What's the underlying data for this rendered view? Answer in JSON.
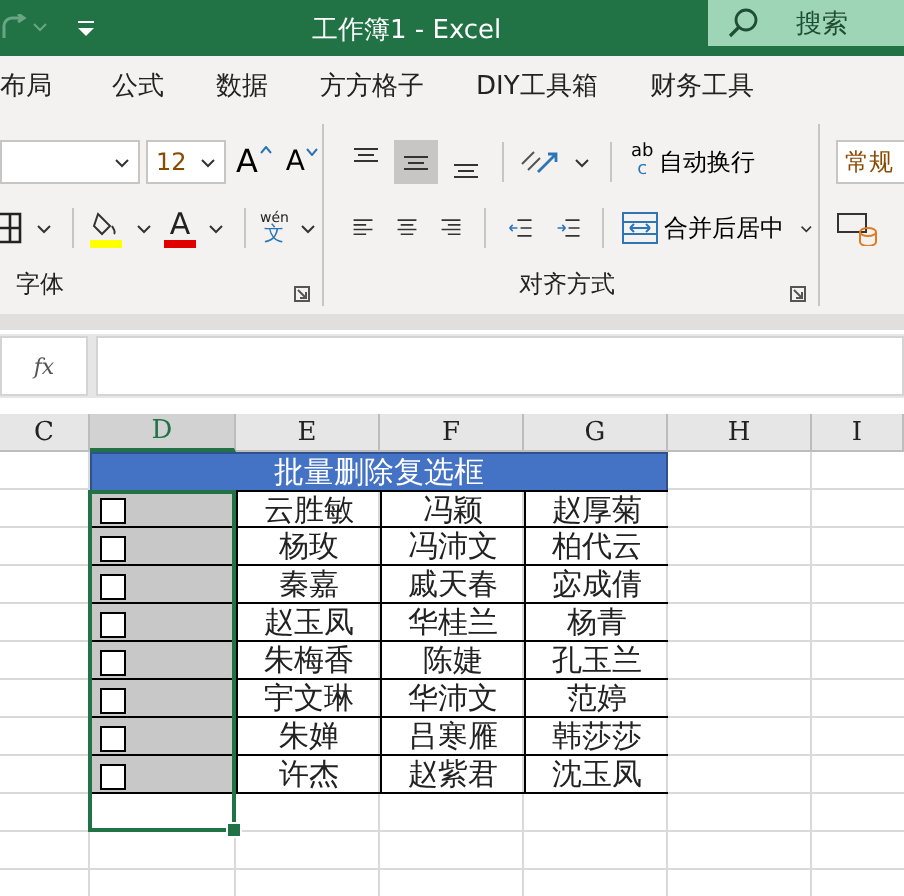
{
  "window": {
    "title": "工作簿1  -  Excel",
    "search_label": "搜索"
  },
  "tabs": [
    "布局",
    "公式",
    "数据",
    "方方格子",
    "DIY工具箱",
    "财务工具"
  ],
  "ribbon": {
    "font_size": "12",
    "grow_font": "A",
    "shrink_font": "A",
    "font_color_letter": "A",
    "phonetic_top": "wén",
    "phonetic_bottom": "文",
    "font_group_label": "字体",
    "align_buttons": [
      {
        "selected": false
      },
      {
        "selected": true
      },
      {
        "selected": false
      }
    ],
    "wrap_icon_top": "ab",
    "wrap_icon_bottom": "c",
    "wrap_text": "自动换行",
    "merge_center": "合并后居中",
    "align_group_label": "对齐方式",
    "number_format": "常规"
  },
  "formula_bar": {
    "fx": "fx"
  },
  "columns": [
    {
      "label": "C",
      "selected": false
    },
    {
      "label": "D",
      "selected": true
    },
    {
      "label": "E",
      "selected": false
    },
    {
      "label": "F",
      "selected": false
    },
    {
      "label": "G",
      "selected": false
    },
    {
      "label": "H",
      "selected": false
    },
    {
      "label": "I",
      "selected": false
    }
  ],
  "table": {
    "header": "批量删除复选框",
    "rows": [
      {
        "checked": false,
        "names": [
          "云胜敏",
          "冯颖",
          "赵厚菊"
        ]
      },
      {
        "checked": false,
        "names": [
          "杨玫",
          "冯沛文",
          "柏代云"
        ]
      },
      {
        "checked": false,
        "names": [
          "秦嘉",
          "戚天春",
          "宓成倩"
        ]
      },
      {
        "checked": false,
        "names": [
          "赵玉凤",
          "华桂兰",
          "杨青"
        ]
      },
      {
        "checked": false,
        "names": [
          "朱梅香",
          "陈婕",
          "孔玉兰"
        ]
      },
      {
        "checked": false,
        "names": [
          "宇文琳",
          "华沛文",
          "范婷"
        ]
      },
      {
        "checked": false,
        "names": [
          "朱婵",
          "吕寒雁",
          "韩莎莎"
        ]
      },
      {
        "checked": false,
        "names": [
          "许杰",
          "赵紫君",
          "沈玉凤"
        ]
      }
    ]
  }
}
